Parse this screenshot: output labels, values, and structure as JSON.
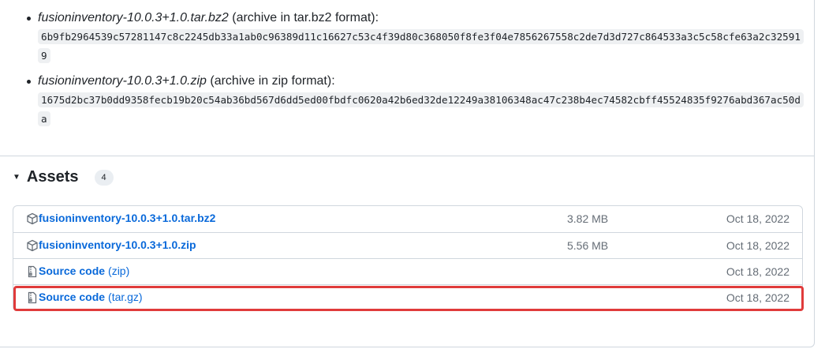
{
  "checksums": [
    {
      "filename": "fusioninventory-10.0.3+1.0.tar.bz2",
      "format": "(archive in tar.bz2 format):",
      "hash": "6b9fb2964539c57281147c8c2245db33a1ab0c96389d11c16627c53c4f39d80c368050f8fe3f04e7856267558c2de7d3d727c864533a3c5c58cfe63a2c325919"
    },
    {
      "filename": "fusioninventory-10.0.3+1.0.zip",
      "format": "(archive in zip format):",
      "hash": "1675d2bc37b0dd9358fecb19b20c54ab36bd567d6dd5ed00fbdfc0620a42b6ed32de12249a38106348ac47c238b4ec74582cbff45524835f9276abd367ac50da"
    }
  ],
  "assets": {
    "title": "Assets",
    "count": "4",
    "rows": [
      {
        "name": "fusioninventory-10.0.3+1.0.tar.bz2",
        "suffix": "",
        "size": "3.82 MB",
        "date": "Oct 18, 2022",
        "icon": "package-icon"
      },
      {
        "name": "fusioninventory-10.0.3+1.0.zip",
        "suffix": "",
        "size": "5.56 MB",
        "date": "Oct 18, 2022",
        "icon": "package-icon"
      },
      {
        "name": "Source code",
        "suffix": "(zip)",
        "size": "",
        "date": "Oct 18, 2022",
        "icon": "file-zip-icon"
      },
      {
        "name": "Source code",
        "suffix": "(tar.gz)",
        "size": "",
        "date": "Oct 18, 2022",
        "icon": "file-zip-icon"
      }
    ]
  },
  "colors": {
    "link": "#0969da",
    "highlight": "#e03b3b",
    "border": "#d0d7de"
  }
}
